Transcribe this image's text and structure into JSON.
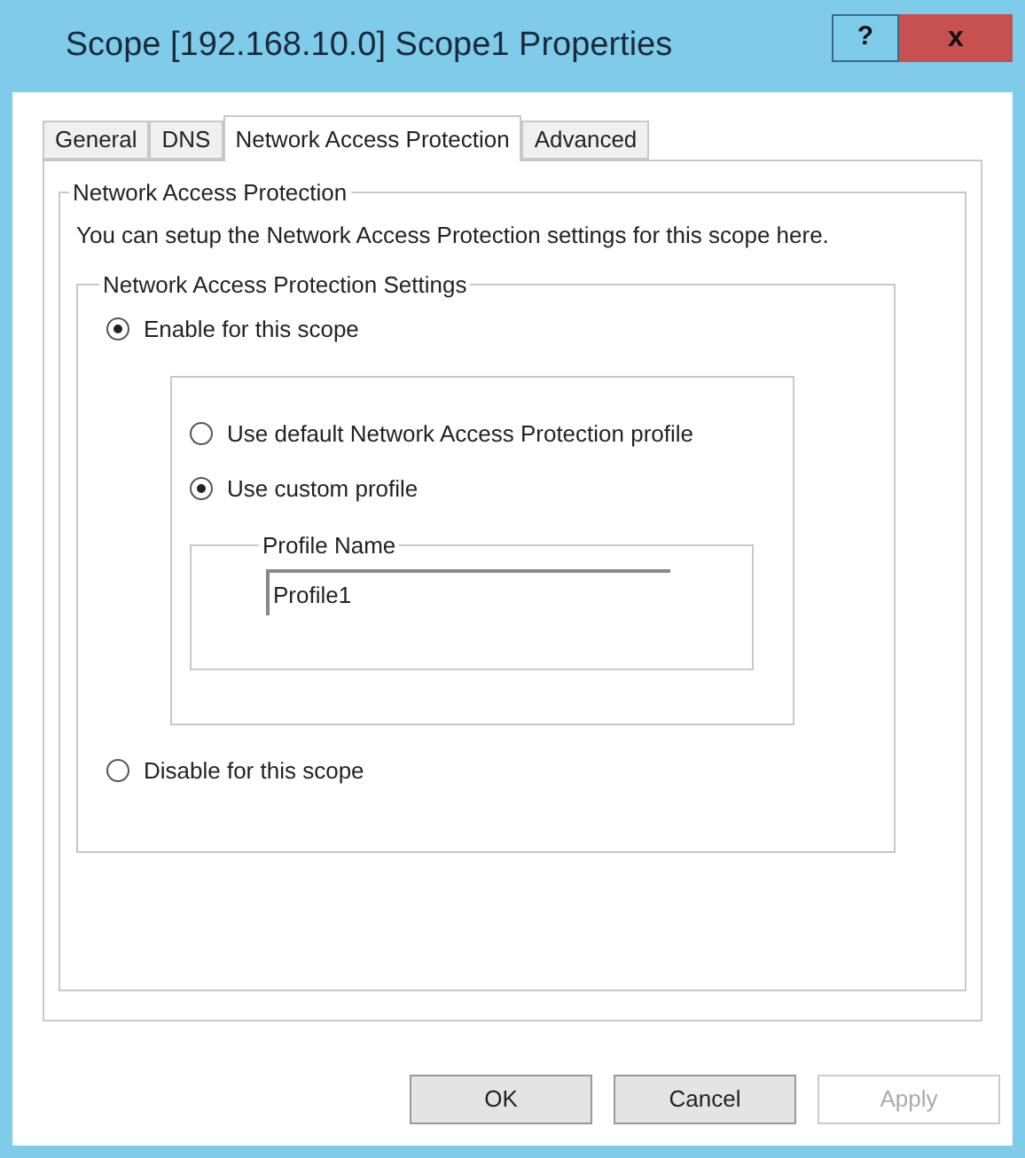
{
  "window": {
    "title": "Scope [192.168.10.0] Scope1 Properties",
    "help_button": "?",
    "close_button": "x"
  },
  "tabs": [
    {
      "label": "General",
      "selected": false
    },
    {
      "label": "DNS",
      "selected": false
    },
    {
      "label": "Network Access Protection",
      "selected": true
    },
    {
      "label": "Advanced",
      "selected": false
    }
  ],
  "nap_group": {
    "title": "Network Access Protection",
    "description": "You can setup the Network Access Protection settings for this scope here.",
    "settings_group": {
      "title": "Network Access Protection Settings",
      "enable_option": {
        "label": "Enable for this scope",
        "selected": true
      },
      "profile_options": [
        {
          "label": "Use default Network Access Protection profile",
          "selected": false
        },
        {
          "label": "Use custom profile",
          "selected": true
        }
      ],
      "profile_name": {
        "title": "Profile Name",
        "value": "Profile1"
      },
      "disable_option": {
        "label": "Disable for this scope",
        "selected": false
      }
    }
  },
  "buttons": [
    {
      "label": "OK",
      "disabled": false
    },
    {
      "label": "Cancel",
      "disabled": false
    },
    {
      "label": "Apply",
      "disabled": true
    }
  ]
}
